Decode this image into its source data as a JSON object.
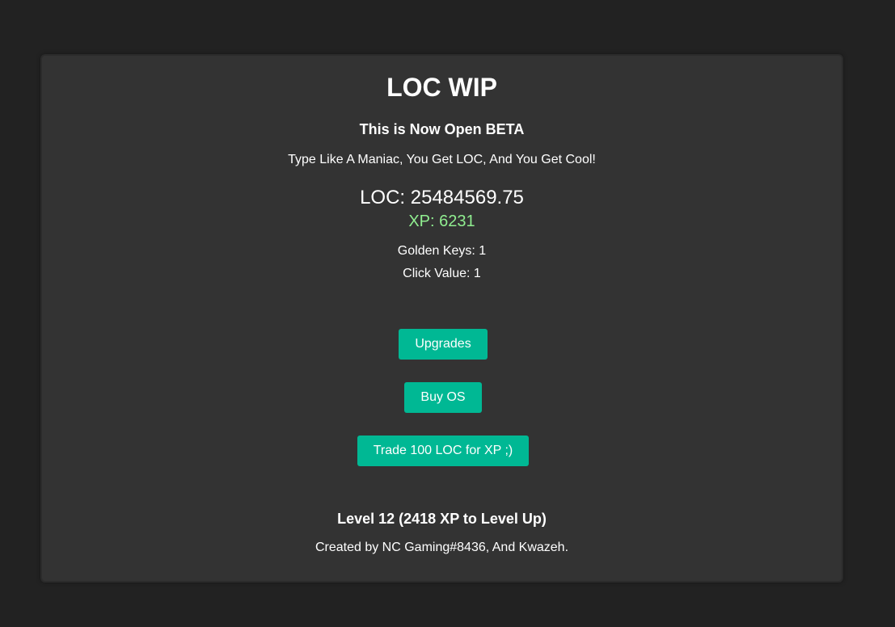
{
  "header": {
    "title": "LOC WIP",
    "subtitle": "This is Now Open BETA",
    "tagline": "Type Like A Maniac, You Get LOC, And You Get Cool!"
  },
  "stats": {
    "loc_text": "LOC: 25484569.75",
    "xp_text": "XP: 6231",
    "golden_keys_text": "Golden Keys: 1",
    "click_value_text": "Click Value: 1"
  },
  "buttons": {
    "upgrades_label": "Upgrades",
    "buy_os_label": "Buy OS",
    "trade_label": "Trade 100 LOC for XP ;)"
  },
  "footer": {
    "level_text": "Level 12 (2418 XP to Level Up)",
    "credits_text": "Created by NC Gaming#8436, And Kwazeh."
  },
  "colors": {
    "page_background": "#222222",
    "card_background": "#333333",
    "accent_button": "#00b894",
    "xp_text": "#90ee90",
    "text": "#ffffff"
  }
}
